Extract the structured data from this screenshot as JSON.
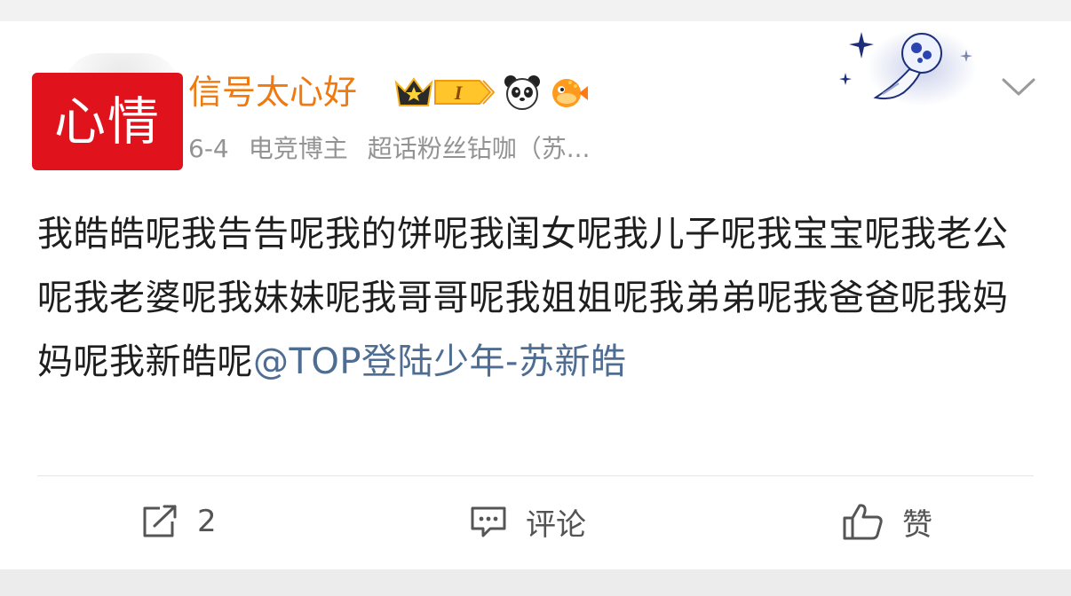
{
  "post": {
    "avatar_badge_text": "心情",
    "username": "信号太心好",
    "badges": [
      "crown-level-badge",
      "panda-icon",
      "pufferfish-icon"
    ],
    "level_badge_text": "I",
    "meta": {
      "date": "6-4",
      "role": "电竞博主",
      "fan_title": "超话粉丝钻咖（苏..."
    },
    "content_text": "我皓皓呢我告告呢我的饼呢我闺女呢我儿子呢我宝宝呢我老公呢我老婆呢我妹妹呢我哥哥呢我姐姐呢我弟弟呢我爸爸呢我妈妈呢我新皓呢",
    "mention": "@TOP登陆少年-苏新皓"
  },
  "actions": {
    "share_count": "2",
    "comment_label": "评论",
    "like_label": "赞"
  },
  "colors": {
    "username": "#f07a10",
    "mention": "#4f6d92",
    "badge_red": "#e0121c",
    "meta_gray": "#939393"
  }
}
